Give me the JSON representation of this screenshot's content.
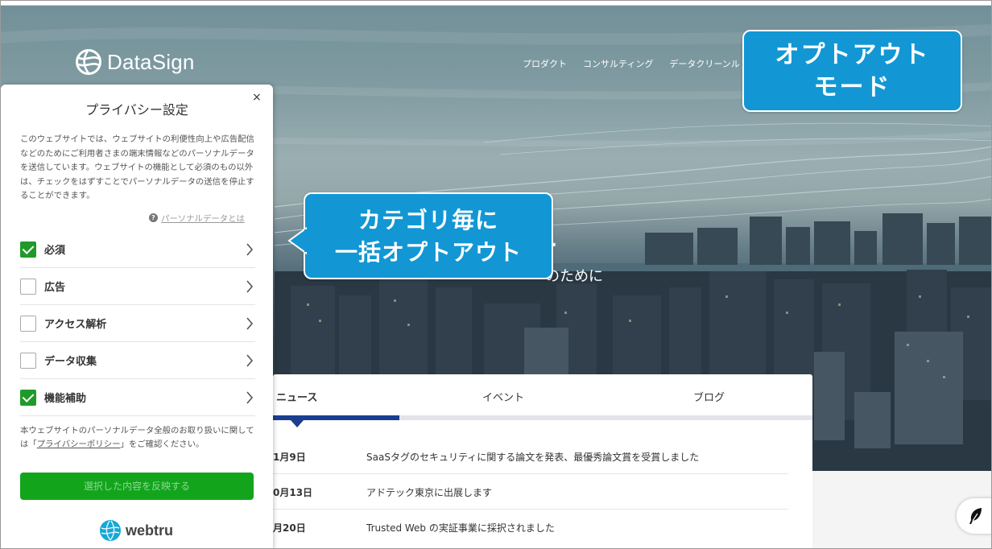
{
  "header": {
    "logo_text": "DataSign",
    "nav": [
      "プロダクト",
      "コンサルティング",
      "データクリーンル"
    ]
  },
  "hero": {
    "title_fragment": "ta",
    "subtitle_fragment": "のために"
  },
  "callouts": {
    "optout_mode": [
      "オプトアウト",
      "モード"
    ],
    "category_optout": [
      "カテゴリ毎に",
      "一括オプトアウト"
    ]
  },
  "privacy_panel": {
    "title": "プライバシー設定",
    "close": "×",
    "description": "このウェブサイトでは、ウェブサイトの利便性向上や広告配信などのためにご利用者さまの端末情報などのパーソナルデータを送信しています。ウェブサイトの機能として必須のもの以外は、チェックをはずすことでパーソナルデータの送信を停止することができます。",
    "info_link": "パーソナルデータとは",
    "categories": [
      {
        "label": "必須",
        "checked": true
      },
      {
        "label": "広告",
        "checked": false
      },
      {
        "label": "アクセス解析",
        "checked": false
      },
      {
        "label": "データ収集",
        "checked": false
      },
      {
        "label": "機能補助",
        "checked": true
      }
    ],
    "note_before": "本ウェブサイトのパーソナルデータ全般のお取り扱いに関しては「",
    "note_link": "プライバシーポリシー",
    "note_after": "」をご確認ください。",
    "apply_button": "選択した内容を反映する",
    "brand": "webtru"
  },
  "news": {
    "tabs": [
      "ニュース",
      "イベント",
      "ブログ"
    ],
    "active_tab": "ニュース",
    "items": [
      {
        "date": "1月9日",
        "title": "SaaSタグのセキュリティに関する論文を発表、最優秀論文賞を受賞しました"
      },
      {
        "date": "0月13日",
        "title": "アドテック東京に出展します"
      },
      {
        "date": "月20日",
        "title": "Trusted Web の実証事業に採択されました"
      }
    ]
  },
  "colors": {
    "callout": "#1297d4",
    "check_green": "#1f9a2a",
    "apply_button": "#12a51c",
    "tab_active": "#1b3f8e"
  },
  "icons": {
    "logo": "globe-icon",
    "close": "close-icon",
    "info": "question-circle-icon",
    "chevron": "chevron-right-icon",
    "feather": "feather-icon",
    "webtru": "webtru-logo-icon"
  }
}
